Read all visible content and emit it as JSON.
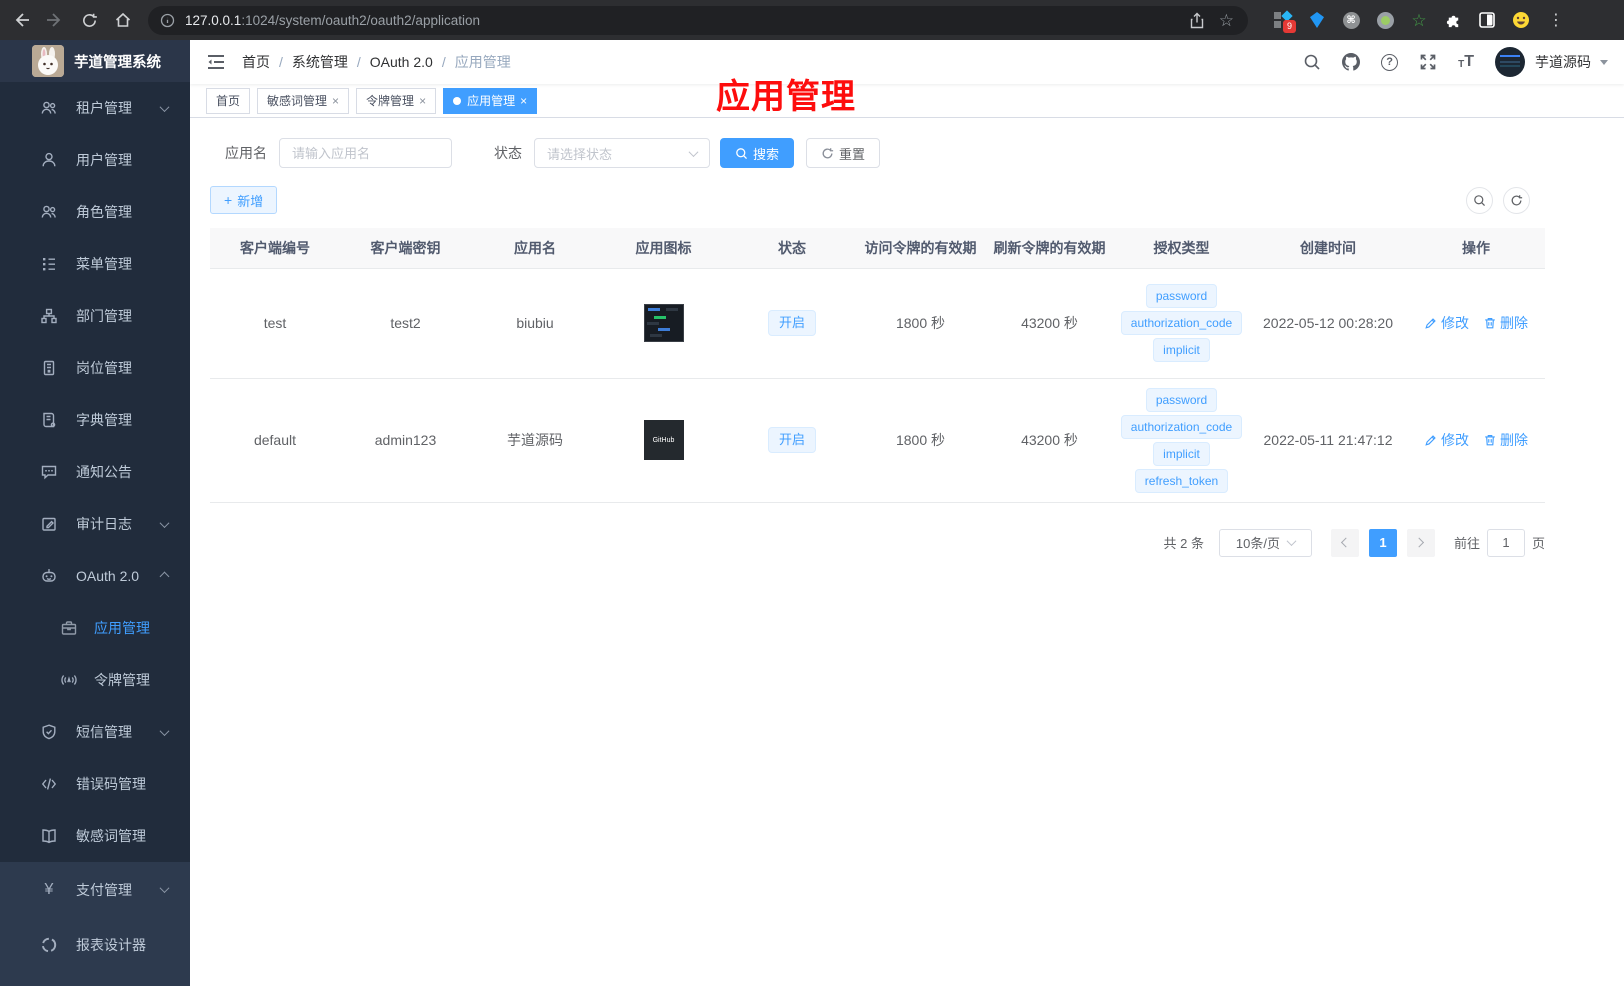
{
  "browser": {
    "url_host": "127.0.0.1",
    "url_path": ":1024/system/oauth2/oauth2/application",
    "ext_badge": "9"
  },
  "icons": {
    "close": "×",
    "kebab": "⋮",
    "star": "☆",
    "command": "⌘",
    "plus": "+",
    "yen": "¥",
    "question": "?",
    "letter_t": "T"
  },
  "sidebar": {
    "title": "芋道管理系统",
    "items": [
      {
        "label": "租户管理"
      },
      {
        "label": "用户管理"
      },
      {
        "label": "角色管理"
      },
      {
        "label": "菜单管理"
      },
      {
        "label": "部门管理"
      },
      {
        "label": "岗位管理"
      },
      {
        "label": "字典管理"
      },
      {
        "label": "通知公告"
      },
      {
        "label": "审计日志"
      },
      {
        "label": "OAuth 2.0"
      },
      {
        "label": "应用管理"
      },
      {
        "label": "令牌管理"
      },
      {
        "label": "短信管理"
      },
      {
        "label": "错误码管理"
      },
      {
        "label": "敏感词管理"
      },
      {
        "label": "支付管理"
      },
      {
        "label": "报表设计器"
      }
    ]
  },
  "header": {
    "breadcrumb": [
      "首页",
      "系统管理",
      "OAuth 2.0",
      "应用管理"
    ],
    "username": "芋道源码"
  },
  "tabs": [
    {
      "label": "首页"
    },
    {
      "label": "敏感词管理"
    },
    {
      "label": "令牌管理"
    },
    {
      "label": "应用管理"
    }
  ],
  "annotation": {
    "text": "应用管理"
  },
  "filters": {
    "name_label": "应用名",
    "name_placeholder": "请输入应用名",
    "status_label": "状态",
    "status_placeholder": "请选择状态",
    "search_label": "搜索",
    "reset_label": "重置"
  },
  "toolbar": {
    "add_label": "新增"
  },
  "table": {
    "headers": [
      "客户端编号",
      "客户端密钥",
      "应用名",
      "应用图标",
      "状态",
      "访问令牌的有效期",
      "刷新令牌的有效期",
      "授权类型",
      "创建时间",
      "操作"
    ],
    "actions": {
      "edit": "修改",
      "delete": "删除"
    },
    "rows": [
      {
        "client_id": "test",
        "client_secret": "test2",
        "name": "biubiu",
        "status": "开启",
        "access_validity": "1800 秒",
        "refresh_validity": "43200 秒",
        "grants": [
          "password",
          "authorization_code",
          "implicit"
        ],
        "created": "2022-05-12 00:28:20"
      },
      {
        "client_id": "default",
        "client_secret": "admin123",
        "name": "芋道源码",
        "icon_text": "GitHub",
        "status": "开启",
        "access_validity": "1800 秒",
        "refresh_validity": "43200 秒",
        "grants": [
          "password",
          "authorization_code",
          "implicit",
          "refresh_token"
        ],
        "created": "2022-05-11 21:47:12"
      }
    ]
  },
  "pagination": {
    "total": "共 2 条",
    "page_size": "10条/页",
    "current_page": "1",
    "goto_label": "前往",
    "goto_value": "1",
    "page_unit": "页"
  },
  "colors": {
    "accent": "#409eff",
    "tag_bg": "#ecf5ff",
    "sidebar_dark": "#212c3c",
    "annotation_red": "#fd0d0d"
  }
}
